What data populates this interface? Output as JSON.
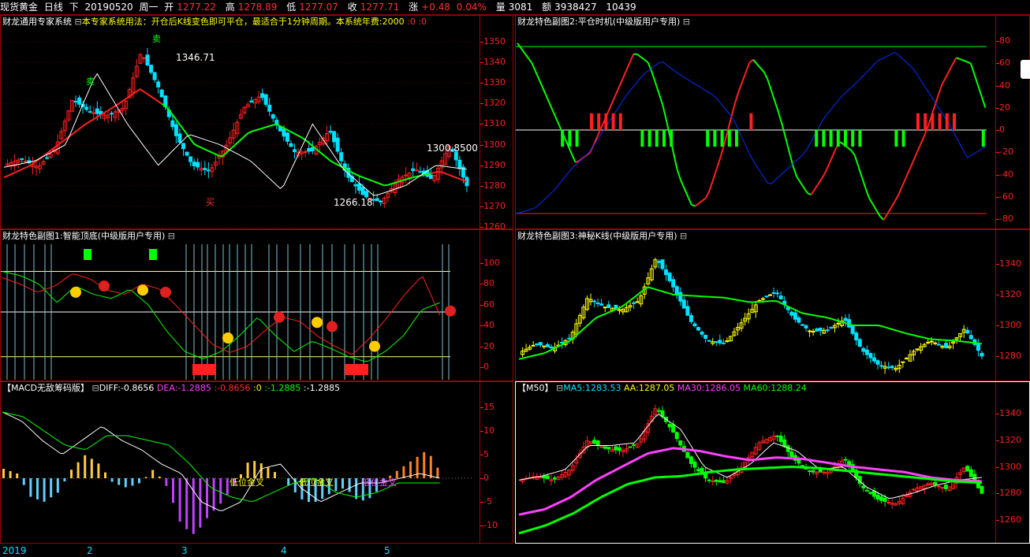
{
  "header": {
    "instrument": "现货黄金",
    "period": "日线",
    "direction": "下",
    "date": "20190520",
    "weekday": "周一",
    "open_label": "开",
    "open": "1277.22",
    "high_label": "高",
    "high": "1278.89",
    "low_label": "低",
    "low": "1277.07",
    "close_label": "收",
    "close": "1277.71",
    "change_label": "涨",
    "change": "+0.48",
    "change_pct": "0.04%",
    "volume_label": "量",
    "volume": "3081",
    "amount_label": "额",
    "amount": "3938427",
    "extra": "10439"
  },
  "panels": {
    "main": {
      "title": "财龙通用专家系统",
      "note": "本专家系统用法：开仓后K线变色即可平仓，最适合于1分钟周期。本系统年费:2000",
      "suffix": ":0 :0",
      "ticks": [
        "1350",
        "1340",
        "1330",
        "1320",
        "1310",
        "1300",
        "1290",
        "1280",
        "1270",
        "1260"
      ],
      "labels": {
        "peak": "1346.71",
        "low": "1266.18",
        "level": "1300.8500",
        "sell1": "卖",
        "sell2": "卖",
        "buy": "买"
      }
    },
    "sub1": {
      "title": "财龙特色副图1:智能顶底(中级版用户专用)",
      "ticks": [
        "100",
        "80",
        "60",
        "40",
        "20",
        "0"
      ]
    },
    "sub2": {
      "title": "财龙特色副图2:平仓时机(中级版用户专用)",
      "ticks": [
        "80",
        "60",
        "40",
        "20",
        "0",
        "-20",
        "-40",
        "-60",
        "-80"
      ]
    },
    "sub3": {
      "title": "财龙特色副图3:神秘K线(中级版用户专用)",
      "ticks": [
        "1340",
        "1320",
        "1300",
        "1280"
      ]
    },
    "macd": {
      "title": "【MACD无敌筹码版】",
      "diff_label": "DIFF:",
      "diff": "-0.8656",
      "dea_label": "DEA:",
      "dea": "-1.2885",
      "l3": ":-0.8656",
      "l4": ":0",
      "l5": ":-1.2885",
      "l6": ":-1.2885",
      "ticks": [
        "15",
        "10",
        "5",
        "0",
        "-5",
        "-10"
      ],
      "cross": [
        "低位金叉",
        "低位金叉",
        "低位金叉"
      ]
    },
    "ma": {
      "title": "【M50】",
      "ma5_label": "MA5:",
      "ma5": "1283.53",
      "aa_label": "AA:",
      "aa": "1287.05",
      "ma30_label": "MA30:",
      "ma30": "1286.05",
      "ma60_label": "MA60:",
      "ma60": "1288.24",
      "ticks": [
        "1340",
        "1320",
        "1300",
        "1280",
        "1260"
      ]
    }
  },
  "xaxis": [
    "2019",
    "2",
    "3",
    "4",
    "5"
  ],
  "colors": {
    "up": "#ff2020",
    "down": "#00e0ff",
    "frame": "#a00000",
    "green": "#00ff00",
    "yellow": "#ffff00",
    "magenta": "#ff40ff"
  }
}
